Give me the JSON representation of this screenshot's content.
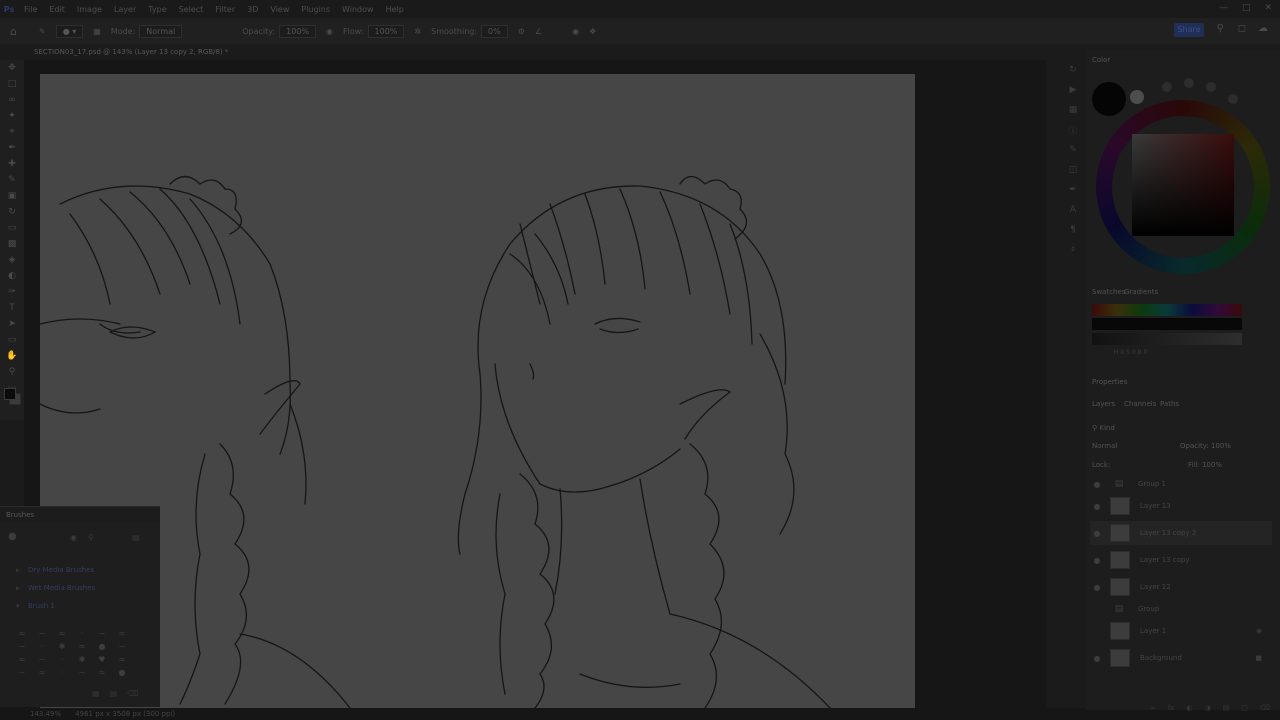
{
  "app": {
    "logo": "Ps",
    "menu": [
      "File",
      "Edit",
      "Image",
      "Layer",
      "Type",
      "Select",
      "Filter",
      "3D",
      "View",
      "Plugins",
      "Window",
      "Help"
    ],
    "window_controls": [
      "minimize-icon",
      "maximize-icon",
      "close-icon"
    ]
  },
  "options_bar": {
    "mode_label": "Mode:",
    "mode_value": "Normal",
    "opacity_label": "Opacity:",
    "opacity_value": "100%",
    "flow_label": "Flow:",
    "flow_value": "100%",
    "smoothing_label": "Smoothing:",
    "smoothing_value": "0%",
    "share_label": "Share"
  },
  "document": {
    "tab_title": "SECTION03_17.psd @ 143% (Layer 13 copy 2, RGB/8) *",
    "zoom": "143.49%",
    "doc_size": "4961 px x 3508 px (300 ppi)"
  },
  "brushes_panel": {
    "title": "Brushes",
    "groups": [
      "Dry Media Brushes",
      "Wet Media Brushes",
      "Brush 1"
    ]
  },
  "color_panel": {
    "title": "Color",
    "tabs": [
      "Swatches",
      "Gradients"
    ],
    "hsb_readout": "H 0  S 0  B 0"
  },
  "properties_panel": {
    "title": "Properties"
  },
  "layers_panel": {
    "tabs": [
      "Layers",
      "Channels",
      "Paths"
    ],
    "blend_mode": "Normal",
    "opacity_label": "Opacity:",
    "opacity_value": "100%",
    "fill_label": "Fill:",
    "fill_value": "100%",
    "lock_label": "Lock:",
    "layers": [
      {
        "name": "Group 1",
        "type": "folder"
      },
      {
        "name": "Layer 13",
        "type": "layer"
      },
      {
        "name": "Layer 13 copy 2",
        "type": "layer",
        "selected": true
      },
      {
        "name": "Layer 13 copy",
        "type": "layer"
      },
      {
        "name": "Layer 12",
        "type": "layer"
      },
      {
        "name": "Group",
        "type": "folder"
      },
      {
        "name": "Layer 1",
        "type": "layer"
      },
      {
        "name": "Background",
        "type": "layer",
        "locked": true
      }
    ]
  },
  "colors": {
    "accent": "#1f2f58",
    "canvas": "#464646",
    "ui_bg": "#1b1b1c"
  }
}
